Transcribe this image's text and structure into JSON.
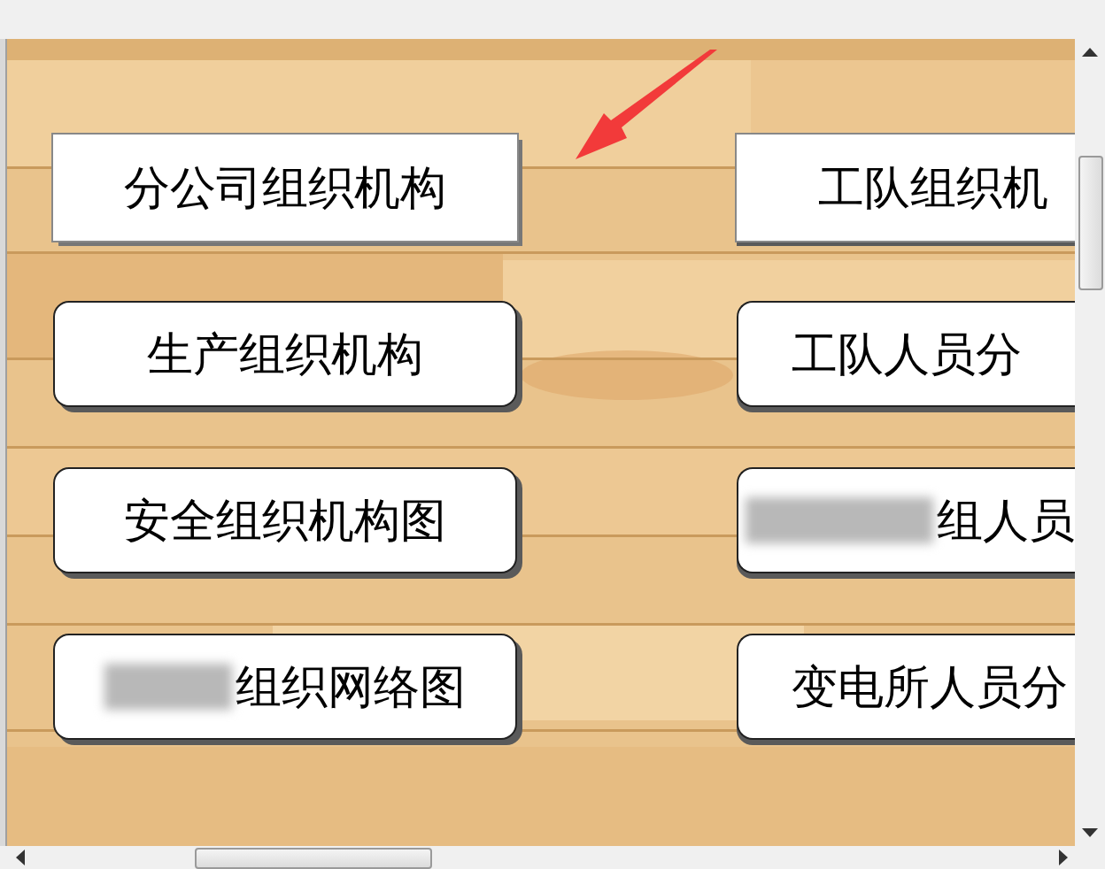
{
  "left_buttons": [
    {
      "label": "分公司组织机构",
      "kind": "square",
      "redacted": false
    },
    {
      "label": "生产组织机构",
      "kind": "rounded",
      "redacted": false
    },
    {
      "label": "安全组织机构图",
      "kind": "rounded",
      "redacted": false
    },
    {
      "label": "组织网络图",
      "kind": "rounded",
      "redacted": true
    }
  ],
  "right_buttons": [
    {
      "label": "工队组织机",
      "kind": "square",
      "redacted": false
    },
    {
      "label": "工队人员分",
      "kind": "rounded",
      "redacted": false
    },
    {
      "label": "组人员",
      "kind": "rounded",
      "redacted": true
    },
    {
      "label": "变电所人员分",
      "kind": "rounded",
      "redacted": false
    }
  ],
  "annotation": {
    "kind": "arrow"
  }
}
